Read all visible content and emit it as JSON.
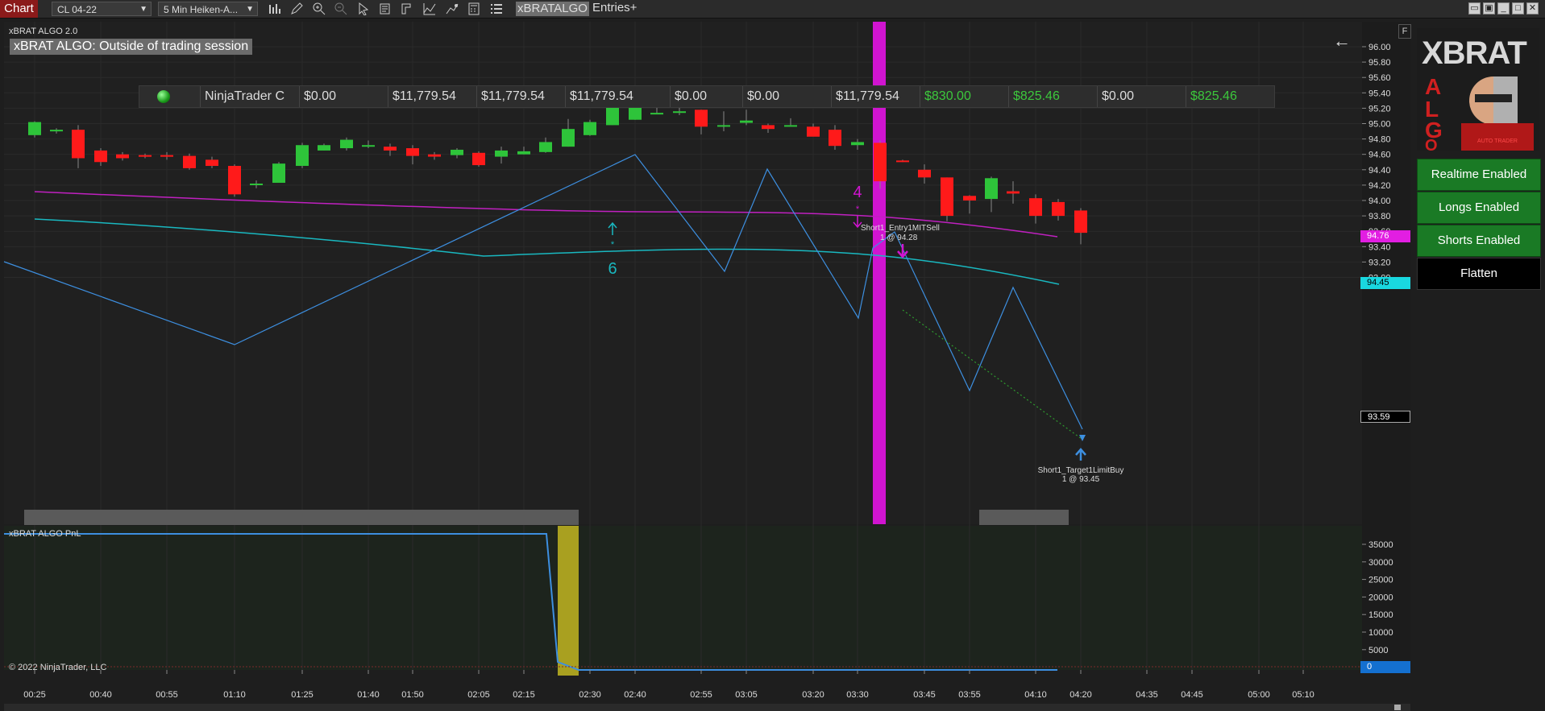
{
  "toolbar": {
    "tab_label": "Chart",
    "instrument": "CL 04-22",
    "bar_type": "5 Min Heiken-A...",
    "strategy_label": "xBRATALGO",
    "entries_label": "Entries+"
  },
  "chart": {
    "indicator_title": "xBRAT ALGO 2.0",
    "status_banner": "xBRAT ALGO: Outside of trading session",
    "pnl_title": "xBRAT ALGO PnL",
    "copyright": "© 2022 NinjaTrader, LLC",
    "f_label": "F",
    "signal_up_count": "6",
    "signal_down_count": "4",
    "entry_label_1": "Short1_Entry1MITSell",
    "entry_label_2": "1 @ 94.28",
    "target_label_1": "Short1_Target1LimitBuy",
    "target_label_2": "1 @ 93.45"
  },
  "account_bar": {
    "account_name": "NinjaTrader C",
    "values": [
      "$0.00",
      "$11,779.54",
      "$11,779.54",
      "$11,779.54",
      "$0.00",
      "$0.00",
      "$11,779.54",
      "$830.00",
      "$825.46",
      "$0.00",
      "$825.46"
    ],
    "value_colors": [
      "#dddddd",
      "#dddddd",
      "#dddddd",
      "#dddddd",
      "#dddddd",
      "#dddddd",
      "#dddddd",
      "#3cc83c",
      "#3cc83c",
      "#dddddd",
      "#3cc83c"
    ]
  },
  "y_axis_main": [
    "96.00",
    "95.80",
    "95.60",
    "95.40",
    "95.20",
    "95.00",
    "94.80",
    "94.60",
    "94.40",
    "94.20",
    "94.00",
    "93.80",
    "93.60",
    "93.40",
    "93.20",
    "93.00"
  ],
  "price_tags": {
    "upper_ma": "94.76",
    "lower_ma": "94.45",
    "last_price": "93.59",
    "pnl_zero": "0"
  },
  "y_axis_pnl": [
    "35000",
    "30000",
    "25000",
    "20000",
    "15000",
    "10000",
    "5000"
  ],
  "x_axis": [
    "00:25",
    "00:40",
    "00:55",
    "01:10",
    "01:25",
    "01:40",
    "01:50",
    "02:05",
    "02:15",
    "02:30",
    "02:40",
    "02:55",
    "03:05",
    "03:20",
    "03:30",
    "03:45",
    "03:55",
    "04:10",
    "04:20",
    "04:35",
    "04:45",
    "05:00",
    "05:10"
  ],
  "right_panel": {
    "logo_text": "XBRAT ALGO",
    "logo_sub": "AUTO TRADER",
    "buttons": [
      "Realtime Enabled",
      "Longs Enabled",
      "Shorts Enabled",
      "Flatten"
    ]
  },
  "colors": {
    "up_candle": "#2ec43a",
    "down_candle": "#ff1a1a",
    "magenta_line": "#c020c0",
    "cyan_line": "#19b8c0",
    "zigzag": "#3d8fe0",
    "session_bar": "#d014d0"
  }
}
